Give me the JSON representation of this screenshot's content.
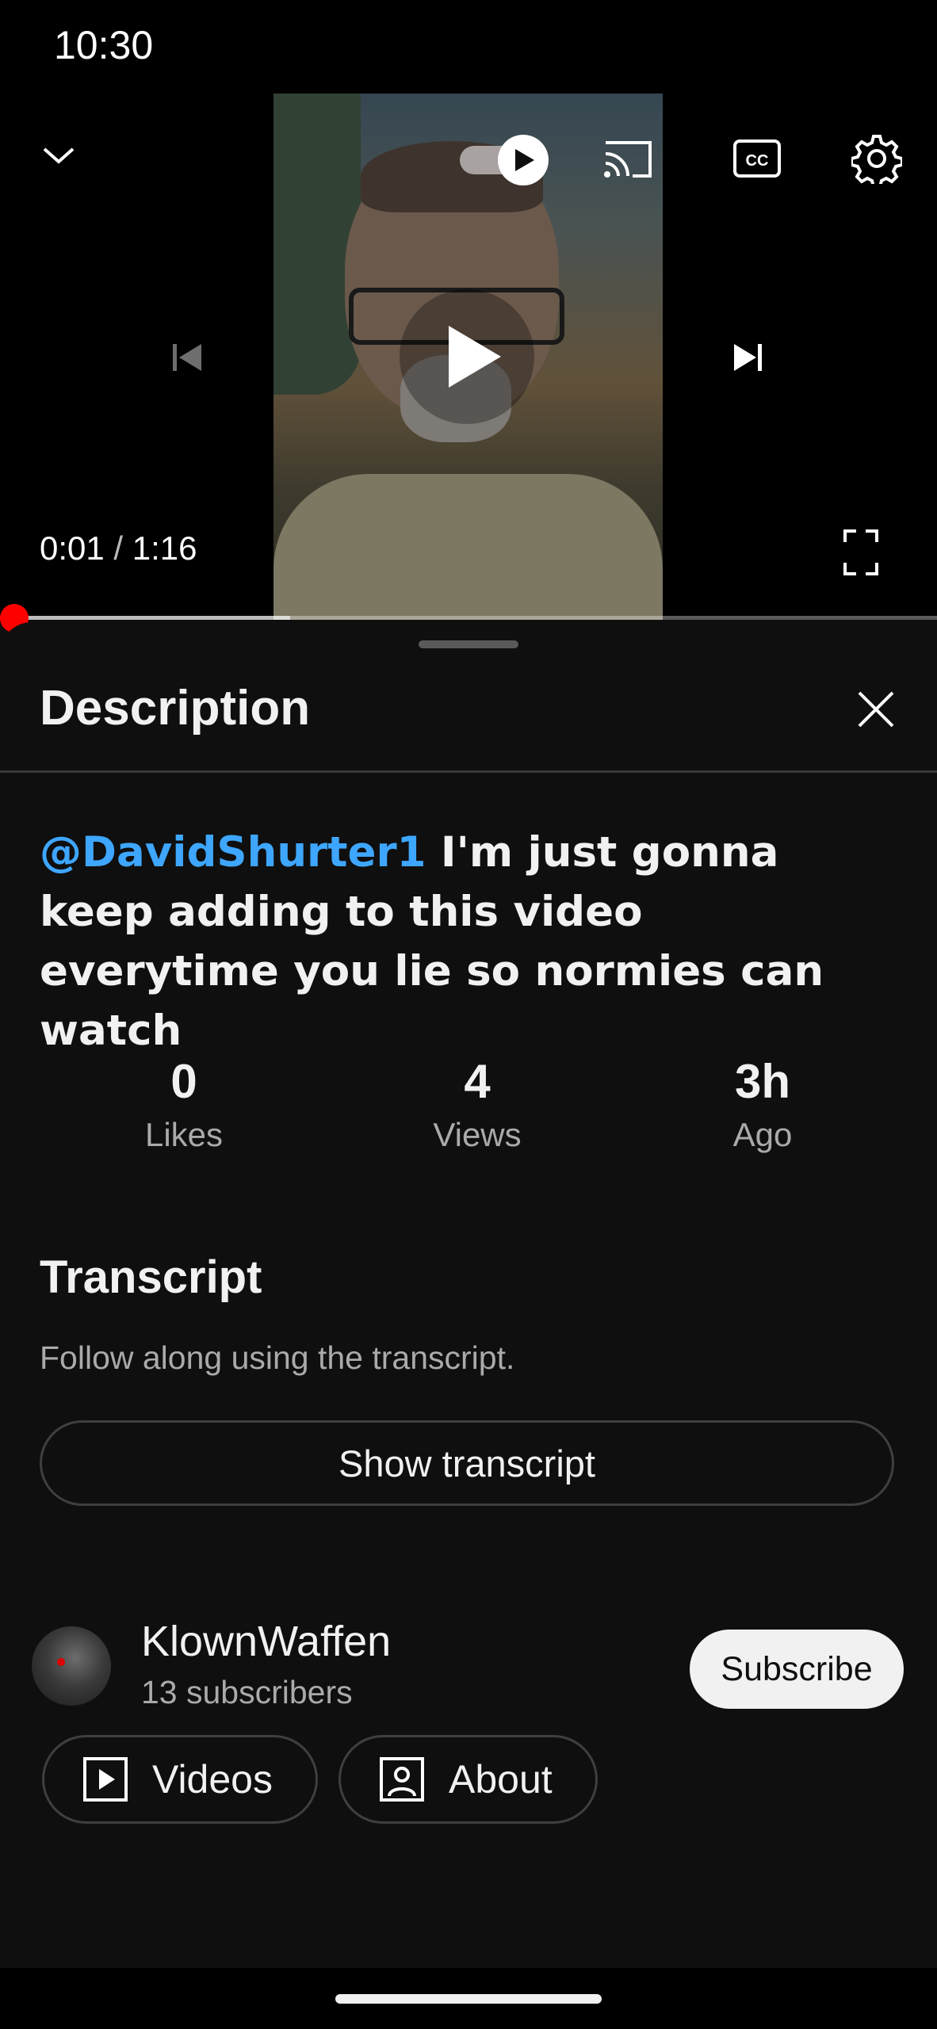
{
  "status_bar": {
    "time": "10:30"
  },
  "player": {
    "time_current": "0:01",
    "time_separator": "/",
    "time_total": "1:16",
    "progress_fraction": 0.013,
    "buffer_fraction": 0.31,
    "icons": {
      "minimize": "chevron-down-icon",
      "autoplay": "autoplay-toggle-icon",
      "cast": "cast-icon",
      "captions": "closed-captions-icon",
      "settings": "gear-icon",
      "previous": "skip-previous-icon",
      "play": "play-icon",
      "next": "skip-next-icon",
      "fullscreen": "fullscreen-icon"
    },
    "accent_color": "#ff0000"
  },
  "description_panel": {
    "title": "Description",
    "mention": "@DavidShurter1",
    "text": " I'm just gonna keep adding to this video everytime you lie so normies can watch",
    "stats": [
      {
        "value": "0",
        "label": "Likes"
      },
      {
        "value": "4",
        "label": "Views"
      },
      {
        "value": "3h",
        "label": "Ago"
      }
    ],
    "transcript": {
      "title": "Transcript",
      "subtitle": "Follow along using the transcript.",
      "button_label": "Show transcript"
    },
    "channel": {
      "name": "KlownWaffen",
      "subscribers": "13 subscribers",
      "subscribe_label": "Subscribe",
      "videos_label": "Videos",
      "about_label": "About"
    },
    "mention_color": "#3ea6ff"
  }
}
